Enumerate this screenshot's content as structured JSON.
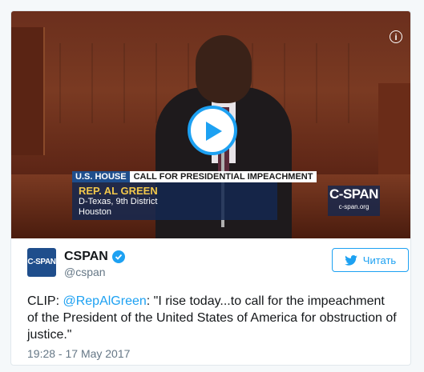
{
  "video": {
    "lower_third": {
      "house": "U.S. HOUSE",
      "topic": "CALL FOR PRESIDENTIAL IMPEACHMENT",
      "name": "REP. AL GREEN",
      "district": "D-Texas, 9th District",
      "city": "Houston"
    },
    "network_logo": {
      "name": "C-SPAN",
      "url": "c-span.org"
    },
    "info_icon": "info-icon",
    "play_icon": "play-icon"
  },
  "tweet": {
    "author_name": "CSPAN",
    "author_handle": "@cspan",
    "avatar_text": "C-SPAN",
    "follow_label": "Читать",
    "text_prefix": "CLIP: ",
    "mention": "@RepAlGreen",
    "text_body": ": \"I rise today...to call for the impeachment of the President of the United States of America for obstruction of justice.\"",
    "timestamp": "19:28 - 17 May 2017"
  },
  "colors": {
    "accent": "#1da1f2",
    "text": "#14171a",
    "muted": "#657786",
    "cspan_blue": "#1f4e8c"
  }
}
